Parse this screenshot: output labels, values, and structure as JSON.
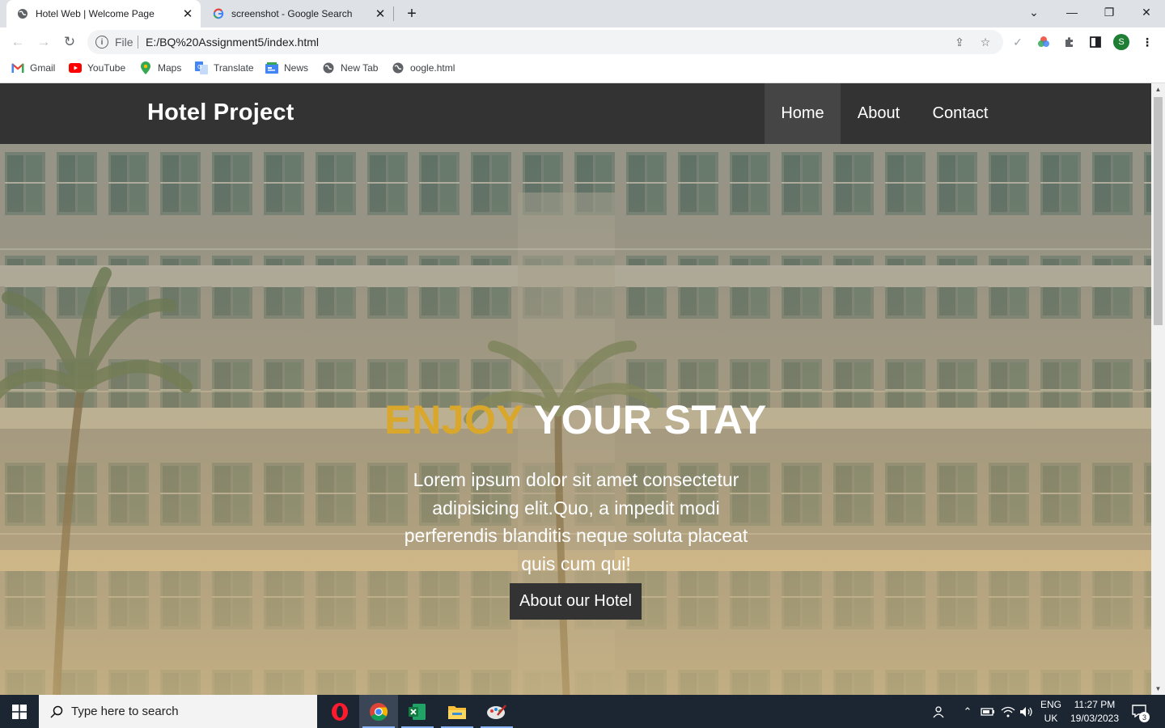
{
  "browser": {
    "tabs": [
      {
        "title": "Hotel Web | Welcome Page",
        "close": "✕"
      },
      {
        "title": "screenshot - Google Search",
        "close": "✕"
      }
    ],
    "new_tab": "+",
    "window_controls": {
      "dropdown": "⌄",
      "minimize": "—",
      "restore": "❐",
      "close": "✕"
    },
    "omnibox": {
      "info": "i",
      "scheme_label": "File",
      "url": "E:/BQ%20Assignment5/index.html"
    },
    "bookmarks": [
      {
        "label": "Gmail",
        "icon": "gmail-icon"
      },
      {
        "label": "YouTube",
        "icon": "youtube-icon"
      },
      {
        "label": "Maps",
        "icon": "maps-icon"
      },
      {
        "label": "Translate",
        "icon": "translate-icon"
      },
      {
        "label": "News",
        "icon": "news-icon"
      },
      {
        "label": "New Tab",
        "icon": "globe-icon"
      },
      {
        "label": "oogle.html",
        "icon": "globe-icon"
      }
    ],
    "profile_initial": "S"
  },
  "site": {
    "brand": "Hotel Project",
    "nav": [
      {
        "label": "Home",
        "active": true
      },
      {
        "label": "About",
        "active": false
      },
      {
        "label": "Contact",
        "active": false
      }
    ],
    "hero": {
      "title_accent": "ENJOY",
      "title_rest": " YOUR STAY",
      "text": "Lorem ipsum dolor sit amet consectetur adipisicing elit.Quo, a impedit modi perferendis blanditis neque soluta placeat quis cum qui!",
      "button": "About our Hotel"
    },
    "colors": {
      "nav_bg": "#333333",
      "accent": "#d9a72c",
      "button_bg": "#333333"
    }
  },
  "taskbar": {
    "search_placeholder": "Type here to search",
    "language": "ENG",
    "region": "UK",
    "time": "11:27 PM",
    "date": "19/03/2023",
    "notification_count": "3"
  }
}
